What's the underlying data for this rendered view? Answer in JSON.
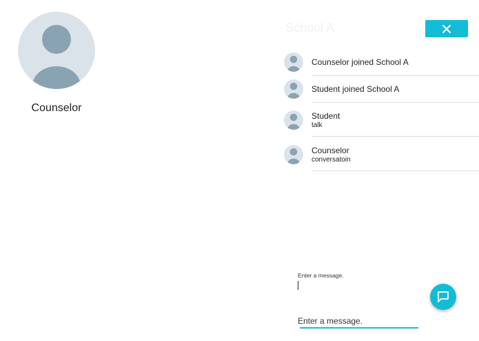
{
  "profile": {
    "avatar_icon": "person-icon",
    "name": "Counselor"
  },
  "room": {
    "title": "School A",
    "close_icon": "close-icon"
  },
  "feed": [
    {
      "text": "Counselor joined School A",
      "sub": ""
    },
    {
      "text": "Student joined School A",
      "sub": ""
    },
    {
      "text": "Student",
      "sub": "talk"
    },
    {
      "text": "Counselor",
      "sub": "conversatoin"
    }
  ],
  "composer": {
    "hint": "Enter a message.",
    "placeholder": "Enter a message.",
    "send_icon": "chat-bubble-icon"
  },
  "colors": {
    "accent": "#13bcd6",
    "avatar_bg": "#dbe3ea",
    "avatar_fg": "#8aa3b3"
  }
}
